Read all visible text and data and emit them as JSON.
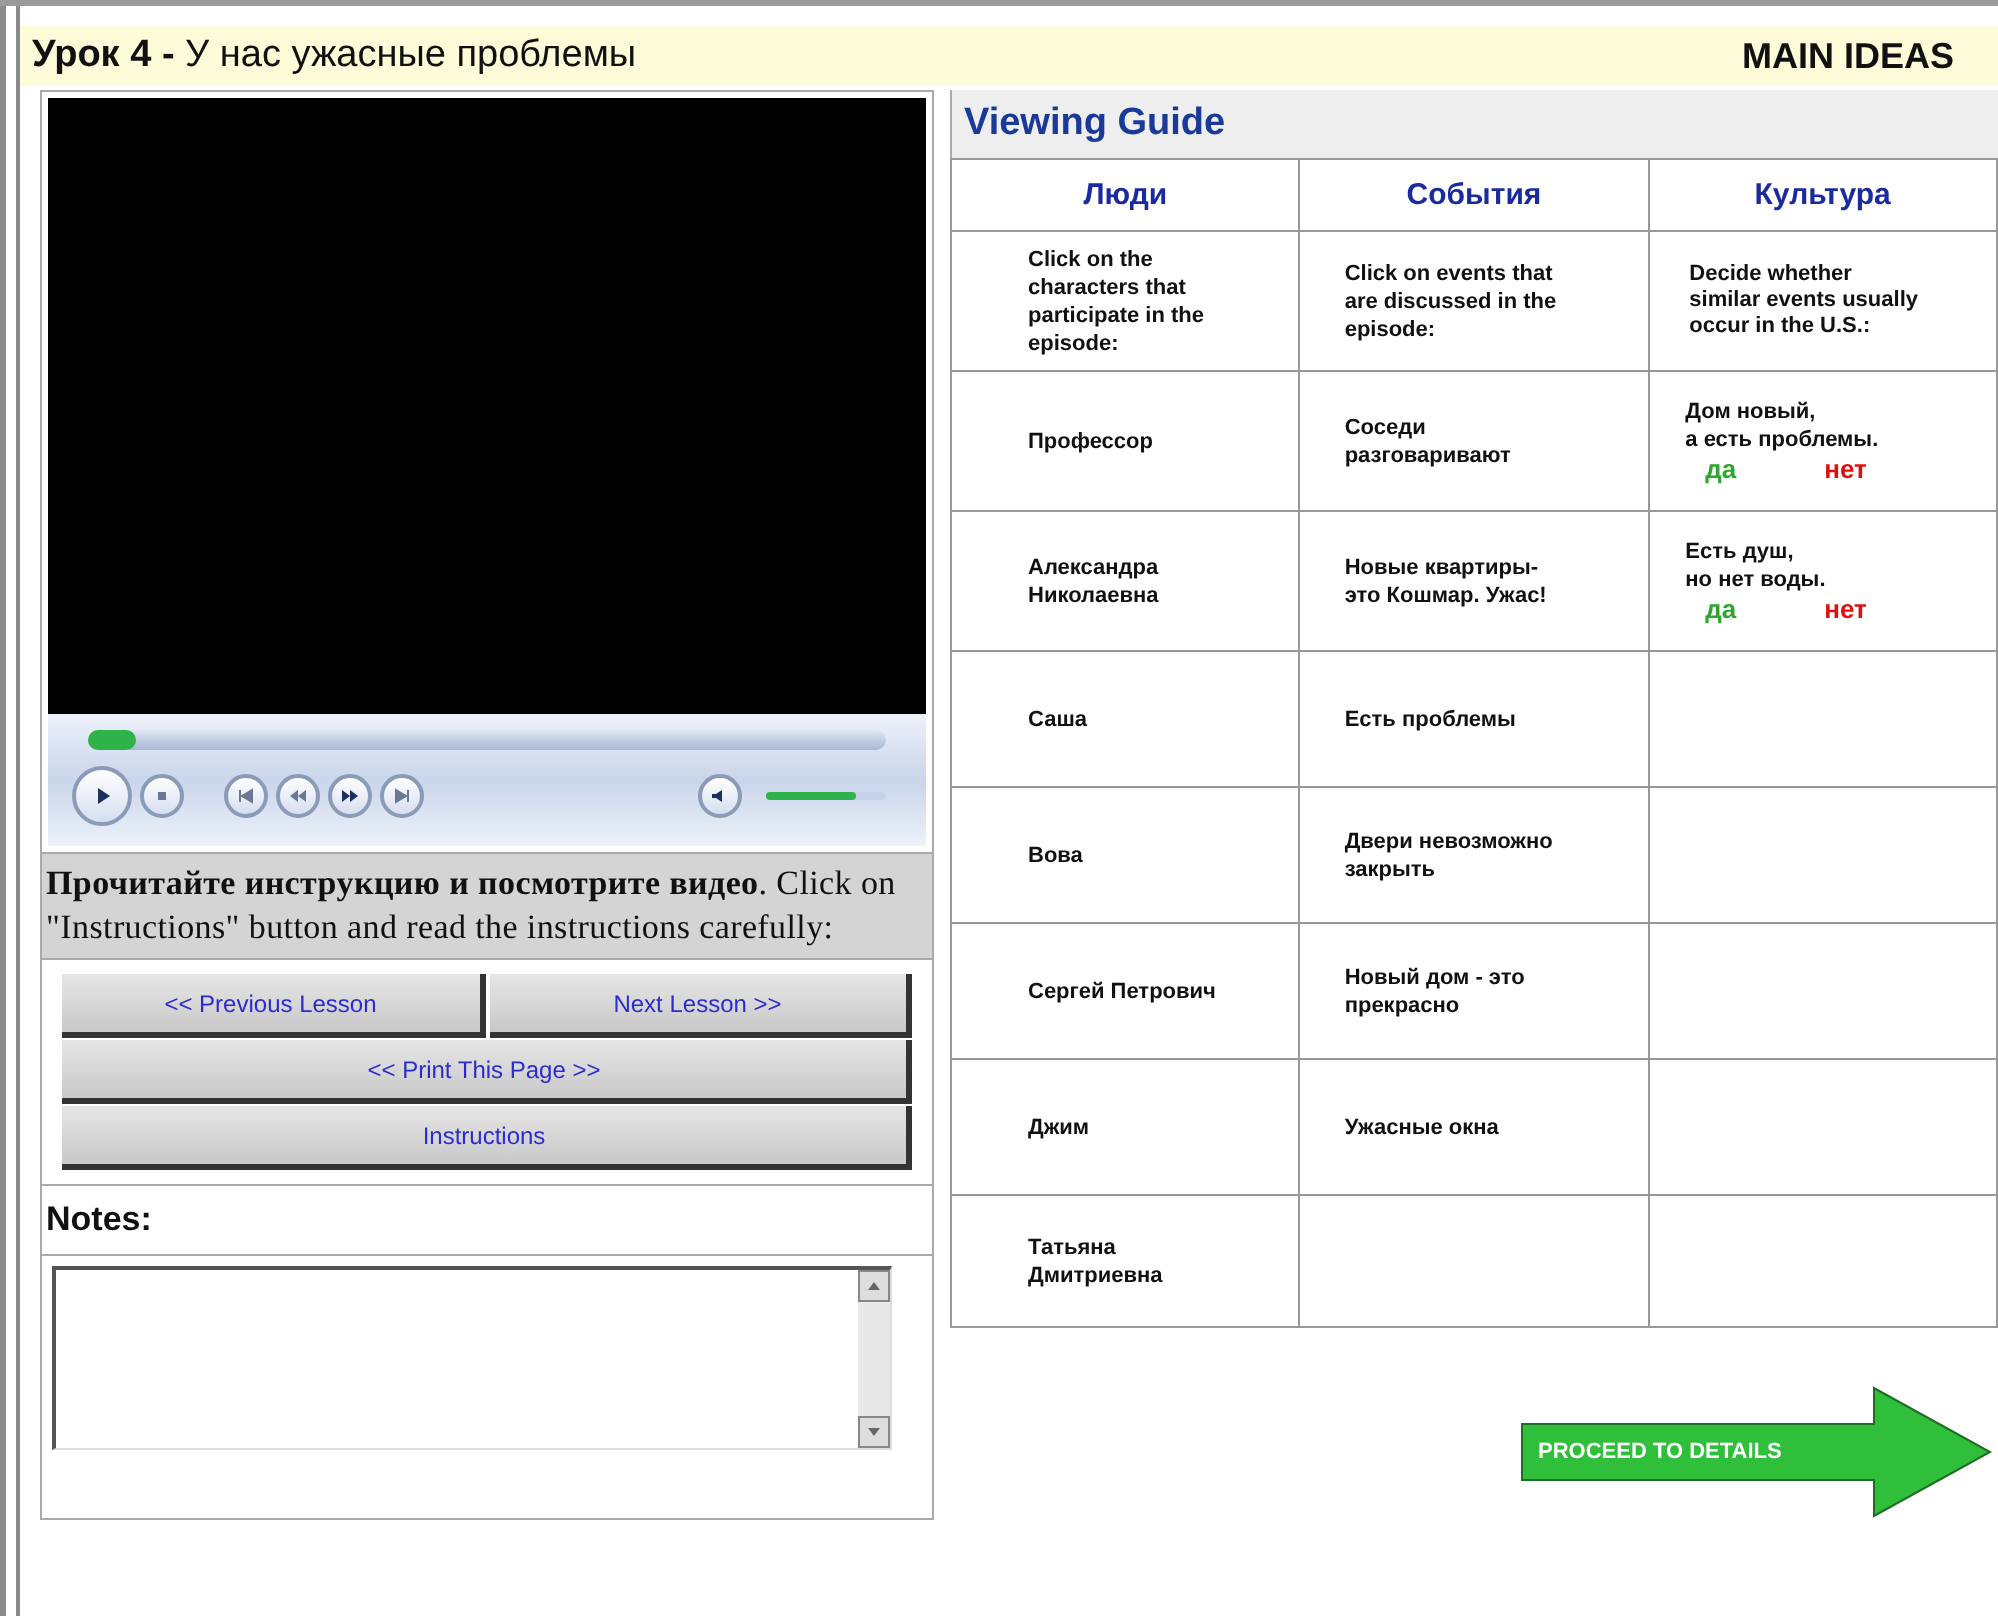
{
  "header": {
    "title": "**Урок 4 -** У нас ужасные проблемы",
    "section": "MAIN IDEAS"
  },
  "player": {
    "seek": {
      "level": 0.06
    },
    "volume": {
      "level": 0.75
    }
  },
  "instructions": "**Прочитайте инструкцию и посмотрите видео**. Click on \"Instructions\" button and read the instructions carefully:",
  "button_rows": [
    [
      "<< Previous Lesson",
      "Next Lesson >>"
    ],
    [
      "<< Print This Page >>"
    ],
    [
      "Instructions"
    ]
  ],
  "notes": {
    "label": "Notes:"
  },
  "viewing_guide": {
    "title": "Viewing Guide",
    "columns": [
      "Люди",
      "События",
      "Культура"
    ],
    "rows": [
      {
        "people": {
          "text": "Click on the characters that participate in the episode:"
        },
        "events": {
          "text": "Click on events that are discussed in the episode:"
        },
        "culture": {
          "kind": "text",
          "text": "Decide whether similar events usually occur in the U.S.:"
        }
      },
      {
        "people": {
          "text": "Профессор"
        },
        "events": {
          "text": "Соседи разговаривают"
        },
        "culture": {
          "kind": "yes_no",
          "lines": [
            "Дом новый,",
            "а есть проблемы."
          ],
          "yes": "да",
          "no": "нет"
        }
      },
      {
        "people": {
          "text": "Александра Николаевна"
        },
        "events": {
          "text": "Новые квартиры- это Кошмар. Ужас!"
        },
        "culture": {
          "kind": "yes_no",
          "lines": [
            "Есть душ,",
            "но нет воды."
          ],
          "yes": "да",
          "no": "нет"
        }
      },
      {
        "people": {
          "text": "Саша"
        },
        "events": {
          "text": "Есть проблемы"
        }
      },
      {
        "people": {
          "text": "Вова"
        },
        "events": {
          "text": "Двери невозможно закрыть"
        }
      },
      {
        "people": {
          "text": "Сергей Петрович"
        },
        "events": {
          "text": "Новый дом - это прекрасно"
        }
      },
      {
        "people": {
          "text": "Джим"
        },
        "events": {
          "text": "Ужасные окна"
        }
      },
      {
        "people": {
          "text": "Татьяна Дмитриевна"
        }
      }
    ]
  },
  "proceed": {
    "label": "PROCEED TO DETAILS"
  }
}
